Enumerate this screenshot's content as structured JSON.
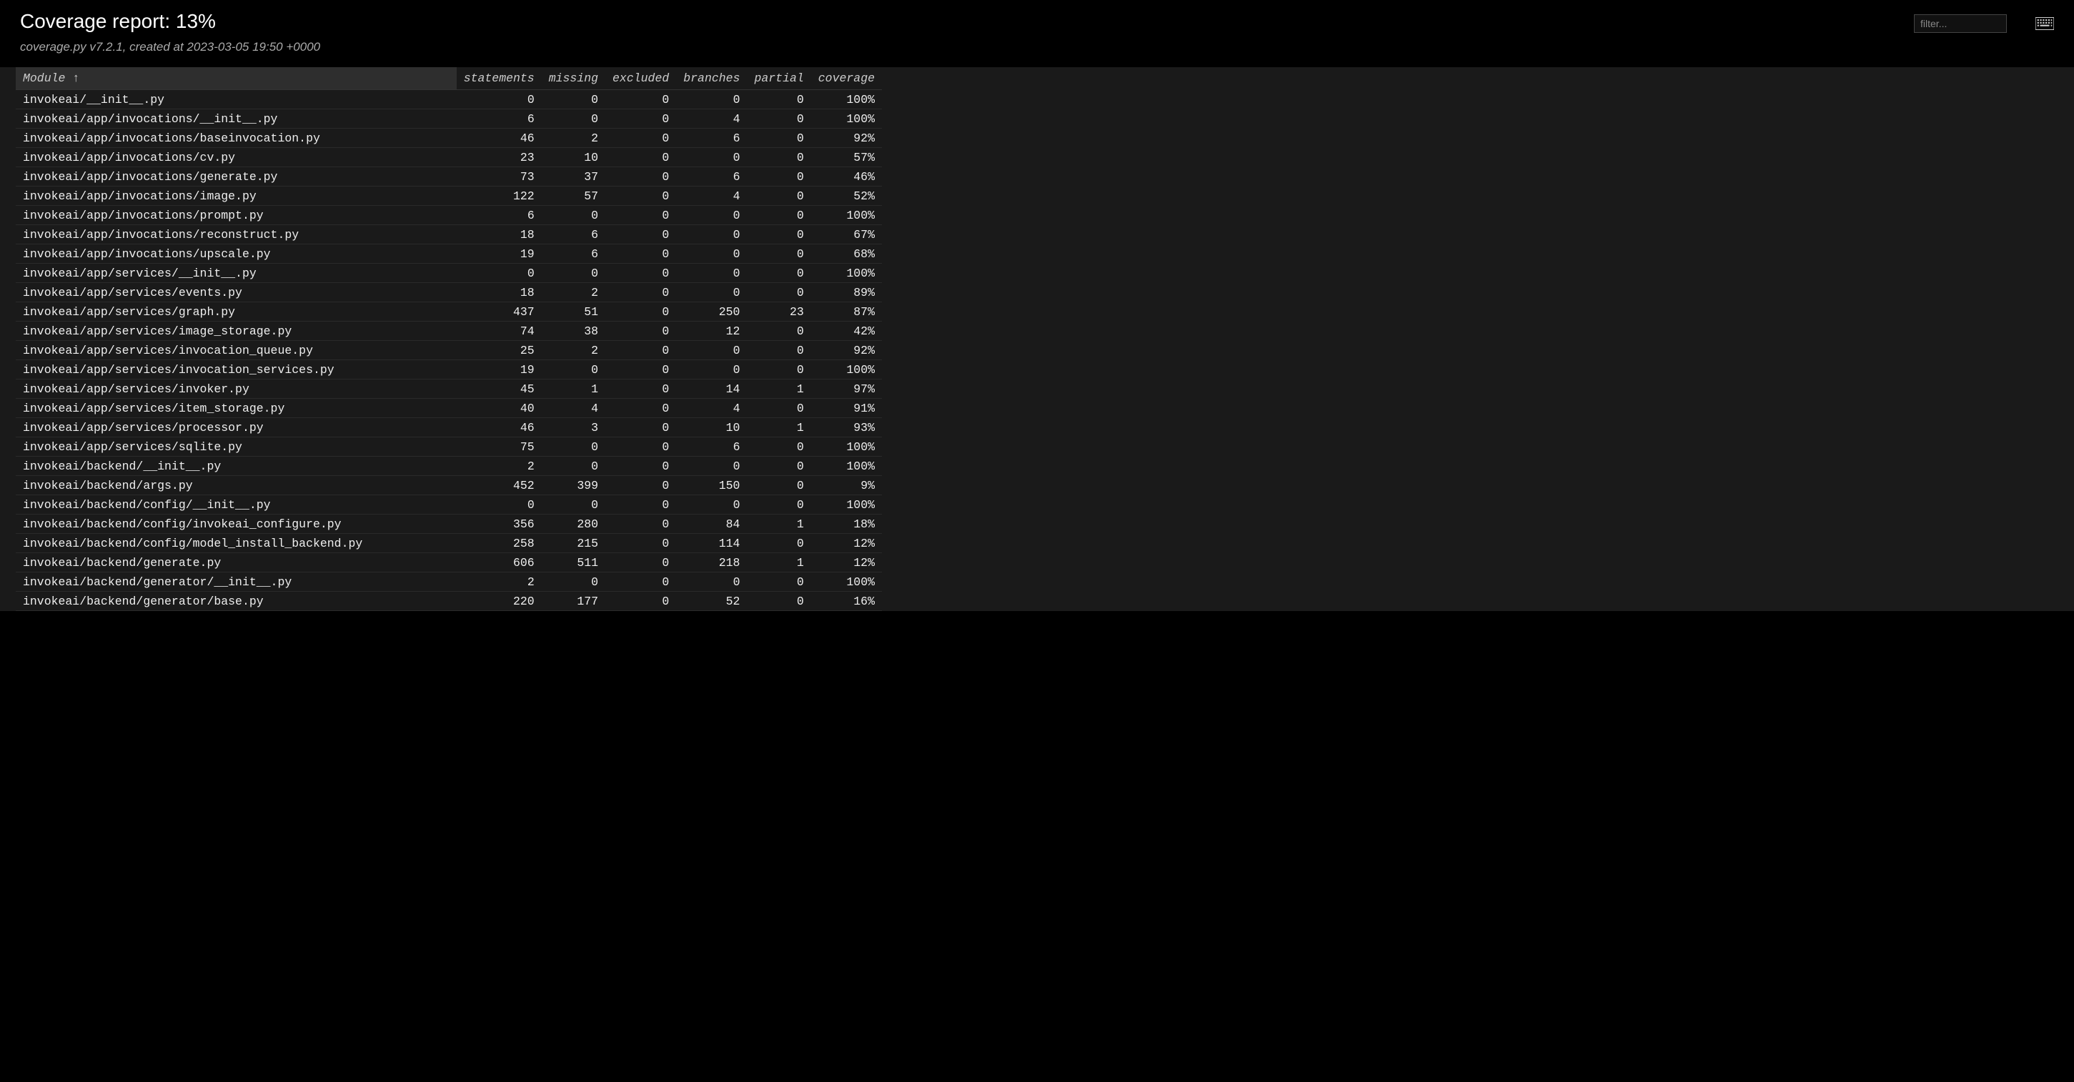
{
  "header": {
    "title": "Coverage report: 13%",
    "subtitle": "coverage.py v7.2.1, created at 2023-03-05 19:50 +0000",
    "filter_placeholder": "filter..."
  },
  "table": {
    "columns": {
      "module": "Module",
      "sort_indicator": "↑",
      "statements": "statements",
      "missing": "missing",
      "excluded": "excluded",
      "branches": "branches",
      "partial": "partial",
      "coverage": "coverage"
    },
    "rows": [
      {
        "module": "invokeai/__init__.py",
        "statements": "0",
        "missing": "0",
        "excluded": "0",
        "branches": "0",
        "partial": "0",
        "coverage": "100%"
      },
      {
        "module": "invokeai/app/invocations/__init__.py",
        "statements": "6",
        "missing": "0",
        "excluded": "0",
        "branches": "4",
        "partial": "0",
        "coverage": "100%"
      },
      {
        "module": "invokeai/app/invocations/baseinvocation.py",
        "statements": "46",
        "missing": "2",
        "excluded": "0",
        "branches": "6",
        "partial": "0",
        "coverage": "92%"
      },
      {
        "module": "invokeai/app/invocations/cv.py",
        "statements": "23",
        "missing": "10",
        "excluded": "0",
        "branches": "0",
        "partial": "0",
        "coverage": "57%"
      },
      {
        "module": "invokeai/app/invocations/generate.py",
        "statements": "73",
        "missing": "37",
        "excluded": "0",
        "branches": "6",
        "partial": "0",
        "coverage": "46%"
      },
      {
        "module": "invokeai/app/invocations/image.py",
        "statements": "122",
        "missing": "57",
        "excluded": "0",
        "branches": "4",
        "partial": "0",
        "coverage": "52%"
      },
      {
        "module": "invokeai/app/invocations/prompt.py",
        "statements": "6",
        "missing": "0",
        "excluded": "0",
        "branches": "0",
        "partial": "0",
        "coverage": "100%"
      },
      {
        "module": "invokeai/app/invocations/reconstruct.py",
        "statements": "18",
        "missing": "6",
        "excluded": "0",
        "branches": "0",
        "partial": "0",
        "coverage": "67%"
      },
      {
        "module": "invokeai/app/invocations/upscale.py",
        "statements": "19",
        "missing": "6",
        "excluded": "0",
        "branches": "0",
        "partial": "0",
        "coverage": "68%"
      },
      {
        "module": "invokeai/app/services/__init__.py",
        "statements": "0",
        "missing": "0",
        "excluded": "0",
        "branches": "0",
        "partial": "0",
        "coverage": "100%"
      },
      {
        "module": "invokeai/app/services/events.py",
        "statements": "18",
        "missing": "2",
        "excluded": "0",
        "branches": "0",
        "partial": "0",
        "coverage": "89%"
      },
      {
        "module": "invokeai/app/services/graph.py",
        "statements": "437",
        "missing": "51",
        "excluded": "0",
        "branches": "250",
        "partial": "23",
        "coverage": "87%"
      },
      {
        "module": "invokeai/app/services/image_storage.py",
        "statements": "74",
        "missing": "38",
        "excluded": "0",
        "branches": "12",
        "partial": "0",
        "coverage": "42%"
      },
      {
        "module": "invokeai/app/services/invocation_queue.py",
        "statements": "25",
        "missing": "2",
        "excluded": "0",
        "branches": "0",
        "partial": "0",
        "coverage": "92%"
      },
      {
        "module": "invokeai/app/services/invocation_services.py",
        "statements": "19",
        "missing": "0",
        "excluded": "0",
        "branches": "0",
        "partial": "0",
        "coverage": "100%"
      },
      {
        "module": "invokeai/app/services/invoker.py",
        "statements": "45",
        "missing": "1",
        "excluded": "0",
        "branches": "14",
        "partial": "1",
        "coverage": "97%"
      },
      {
        "module": "invokeai/app/services/item_storage.py",
        "statements": "40",
        "missing": "4",
        "excluded": "0",
        "branches": "4",
        "partial": "0",
        "coverage": "91%"
      },
      {
        "module": "invokeai/app/services/processor.py",
        "statements": "46",
        "missing": "3",
        "excluded": "0",
        "branches": "10",
        "partial": "1",
        "coverage": "93%"
      },
      {
        "module": "invokeai/app/services/sqlite.py",
        "statements": "75",
        "missing": "0",
        "excluded": "0",
        "branches": "6",
        "partial": "0",
        "coverage": "100%"
      },
      {
        "module": "invokeai/backend/__init__.py",
        "statements": "2",
        "missing": "0",
        "excluded": "0",
        "branches": "0",
        "partial": "0",
        "coverage": "100%"
      },
      {
        "module": "invokeai/backend/args.py",
        "statements": "452",
        "missing": "399",
        "excluded": "0",
        "branches": "150",
        "partial": "0",
        "coverage": "9%"
      },
      {
        "module": "invokeai/backend/config/__init__.py",
        "statements": "0",
        "missing": "0",
        "excluded": "0",
        "branches": "0",
        "partial": "0",
        "coverage": "100%"
      },
      {
        "module": "invokeai/backend/config/invokeai_configure.py",
        "statements": "356",
        "missing": "280",
        "excluded": "0",
        "branches": "84",
        "partial": "1",
        "coverage": "18%"
      },
      {
        "module": "invokeai/backend/config/model_install_backend.py",
        "statements": "258",
        "missing": "215",
        "excluded": "0",
        "branches": "114",
        "partial": "0",
        "coverage": "12%"
      },
      {
        "module": "invokeai/backend/generate.py",
        "statements": "606",
        "missing": "511",
        "excluded": "0",
        "branches": "218",
        "partial": "1",
        "coverage": "12%"
      },
      {
        "module": "invokeai/backend/generator/__init__.py",
        "statements": "2",
        "missing": "0",
        "excluded": "0",
        "branches": "0",
        "partial": "0",
        "coverage": "100%"
      },
      {
        "module": "invokeai/backend/generator/base.py",
        "statements": "220",
        "missing": "177",
        "excluded": "0",
        "branches": "52",
        "partial": "0",
        "coverage": "16%"
      }
    ]
  }
}
